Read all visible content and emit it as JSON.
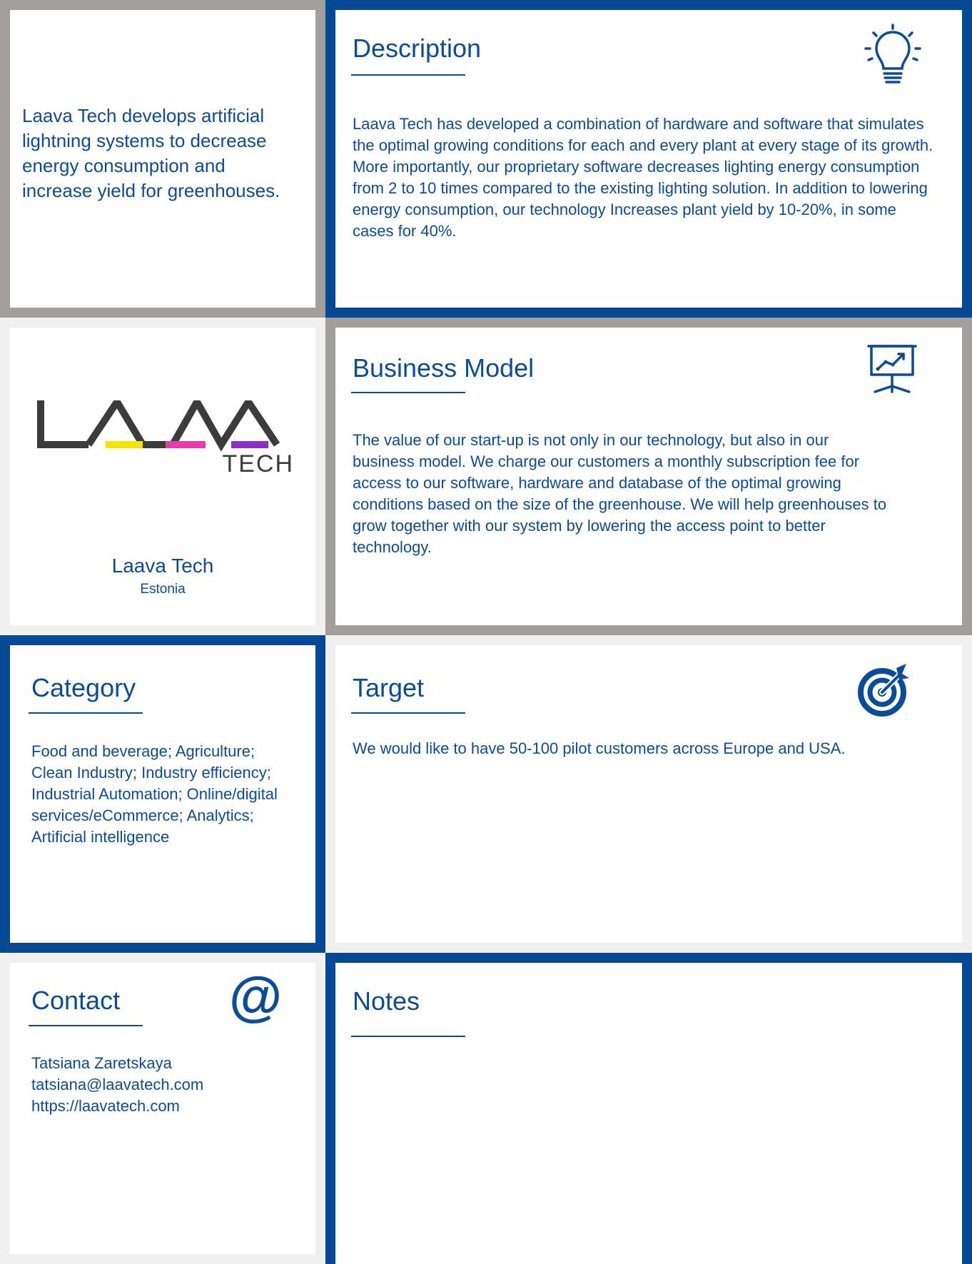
{
  "tagline": "Laava Tech develops artificial lightning systems to decrease energy consumption and increase yield for greenhouses.",
  "description": {
    "title": "Description",
    "text": "Laava Tech has developed a combination of hardware and software that simulates the optimal growing conditions for each and every plant at every stage of its growth. More importantly, our proprietary software decreases lighting energy consumption from 2 to 10 times compared to the existing lighting solution. In addition to lowering energy consumption, our technology Increases plant yield by 10-20%, in some cases for 40%.",
    "icon": "lightbulb-icon"
  },
  "company": {
    "logo_text": "LAAVA",
    "logo_sub": "TECH",
    "name": "Laava Tech",
    "country": "Estonia",
    "logo_colors": [
      "#f2e600",
      "#e93cac",
      "#8b2fc9"
    ]
  },
  "business_model": {
    "title": "Business Model",
    "text": "The value of our start-up is not only in our technology, but also in our business model. We charge our customers a monthly subscription fee for access to our software, hardware and database of the optimal growing conditions based on the size of the greenhouse. We will help greenhouses to grow together with our system by lowering the access point to better technology.",
    "icon": "presentation-chart-icon"
  },
  "category": {
    "title": "Category",
    "text": "Food and beverage; Agriculture; Clean Industry; Industry efficiency; Industrial Automation; Online/digital services/eCommerce; Analytics; Artificial intelligence"
  },
  "target": {
    "title": "Target",
    "text": "We would like to have 50-100 pilot customers across Europe and USA.",
    "icon": "target-icon"
  },
  "contact": {
    "title": "Contact",
    "name": "Tatsiana Zaretskaya",
    "email": "tatsiana@laavatech.com",
    "website": "https://laavatech.com",
    "icon": "at-sign-icon"
  },
  "notes": {
    "title": "Notes"
  },
  "colors": {
    "blue": "#064a96",
    "gray": "#a19e9b",
    "light": "#f1f0f0"
  }
}
